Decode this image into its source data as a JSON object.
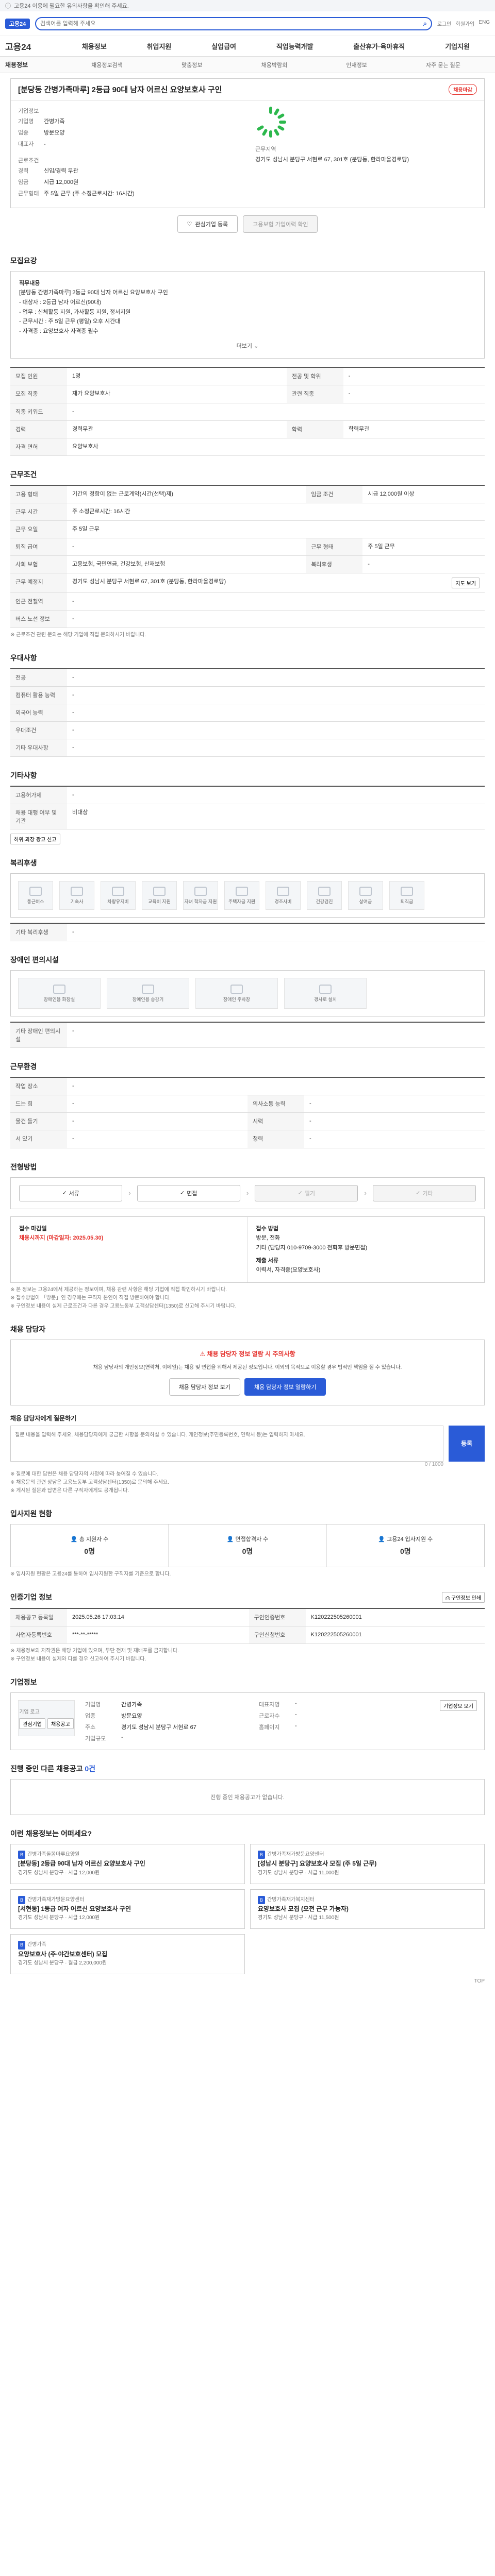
{
  "notice": {
    "text": "고용24 이용에 필요한 유의사항을 확인해 주세요.",
    "close": "닫기"
  },
  "topbar": {
    "logo": "고용24",
    "search_placeholder": "검색어를 입력해 주세요",
    "links": [
      "로그인",
      "회원가입",
      "ENG"
    ]
  },
  "gnb": {
    "brand": "고용24",
    "items": [
      "채용정보",
      "취업지원",
      "실업급여",
      "직업능력개발",
      "출산휴가·육아휴직",
      "기업지원"
    ]
  },
  "lnb": {
    "title": "채용정보",
    "items": [
      "채용정보검색",
      "맞춤정보",
      "채용박람회",
      "인재정보",
      "자주 묻는 질문"
    ]
  },
  "job": {
    "title": "[분당동 간병가족마루] 2등급 90대 남자 어르신 요양보호사 구인",
    "status": "채용마감",
    "company_label": "기업정보",
    "company": [
      {
        "k": "기업명",
        "v": "간병가족"
      },
      {
        "k": "업종",
        "v": "방문요양"
      },
      {
        "k": "대표자",
        "v": "-"
      }
    ],
    "work_label": "근로조건",
    "work": [
      {
        "k": "경력",
        "v": "신입/경력 무관"
      },
      {
        "k": "임금",
        "v": "시급 12,000원"
      },
      {
        "k": "근무형태",
        "v": "주 5일 근무 (주 소정근로시간: 16시간)"
      }
    ],
    "area_label": "근무지역",
    "area": "경기도 성남시 분당구 서현로 67, 301호 (분당동, 한라마을경로당)",
    "apply_btn": "관심기업 등록",
    "consult_btn": "고용보험 가입이력 확인",
    "share_btn": "공유하기"
  },
  "duty": {
    "heading": "모집요강",
    "body": [
      "직무내용",
      "[분당동 간병가족마루] 2등급 90대 남자 어르신 요양보호사 구인",
      "- 대상자 : 2등급 남자 어르신(90대)",
      "- 업무 : 신체활동 지원, 가사활동 지원, 정서지원",
      "- 근무시간 : 주 5일 근무 (평일) 오후 시간대",
      "- 자격증 : 요양보호사 자격증 필수"
    ],
    "more": "더보기"
  },
  "recruit_table": [
    {
      "k": "모집 인원",
      "v": "1명",
      "k2": "전공 및 학위",
      "v2": "-"
    },
    {
      "k": "모집 직종",
      "v": "재가 요양보호사",
      "k2": "관련 직종",
      "v2": "-"
    },
    {
      "k": "직종 키워드",
      "v": "-",
      "k2": "",
      "v2": ""
    },
    {
      "k": "경력",
      "v": "경력무관",
      "k2": "학력",
      "v2": "학력무관"
    },
    {
      "k": "자격 면허",
      "v": "요양보호사",
      "k2": "",
      "v2": ""
    }
  ],
  "work_cond": {
    "heading": "근무조건",
    "rows": [
      {
        "k": "고용 형태",
        "v": "기간의 정함이 없는 근로계약(시간(선택)제)",
        "k2": "임금 조건",
        "v2": "시급 12,000원 이상"
      },
      {
        "k": "근무 시간",
        "v": "주 소정근로시간: 16시간",
        "k2": "",
        "v2": ""
      },
      {
        "k": "근무 요일",
        "v": "주 5일 근무",
        "k2": "",
        "v2": ""
      },
      {
        "k": "퇴직 급여",
        "v": "-",
        "k2": "근무 형태",
        "v2": "주 5일 근무"
      },
      {
        "k": "사회 보험",
        "v": "고용보험, 국민연금, 건강보험, 산재보험",
        "k2": "복리후생",
        "v2": "-"
      },
      {
        "k": "근무 예정지",
        "v": "경기도 성남시 분당구 서현로 67, 301호 (분당동, 한라마을경로당)",
        "k2": "",
        "v2": ""
      },
      {
        "k": "인근 전철역",
        "v": "-",
        "k2": "",
        "v2": ""
      },
      {
        "k": "버스 노선 정보",
        "v": "-",
        "k2": "",
        "v2": ""
      }
    ],
    "map_btn": "지도 보기",
    "note": "※ 근로조건 관련 문의는 해당 기업에 직접 문의하시기 바랍니다."
  },
  "pref": {
    "heading": "우대사항",
    "rows": [
      {
        "k": "전공",
        "v": "-"
      },
      {
        "k": "컴퓨터 활용 능력",
        "v": "-"
      },
      {
        "k": "외국어 능력",
        "v": "-"
      },
      {
        "k": "우대조건",
        "v": "-"
      },
      {
        "k": "기타 우대사항",
        "v": "-"
      }
    ]
  },
  "etc": {
    "heading": "기타사항",
    "rows": [
      {
        "k": "고용허가제",
        "v": "-"
      },
      {
        "k": "채용 대행 여부 및 기관",
        "v": "비대상"
      }
    ],
    "report_btn": "허위·과장 광고 신고"
  },
  "welfare": {
    "heading": "복리후생",
    "items": [
      "통근버스",
      "기숙사",
      "차량유지비",
      "교육비 지원",
      "자녀 학자금 지원",
      "주택자금 지원",
      "경조사비",
      "건강검진",
      "상여금",
      "퇴직금"
    ],
    "etc_label": "기타 복리후생",
    "etc": "-"
  },
  "disabled": {
    "heading": "장애인 편의시설",
    "items": [
      "장애인용 화장실",
      "장애인용 승강기",
      "장애인 주차장",
      "경사로 설치"
    ],
    "etc_label": "기타 장애인 편의시설",
    "etc": "-"
  },
  "welfare_extra": {
    "heading": "근무환경",
    "rows": [
      {
        "k": "작업 장소",
        "v": "-",
        "k2": "",
        "v2": ""
      },
      {
        "k": "드는 힘",
        "v": "-",
        "k2": "의사소통 능력",
        "v2": "-"
      },
      {
        "k": "물건 들기",
        "v": "-",
        "k2": "시력",
        "v2": "-"
      },
      {
        "k": "서 있기",
        "v": "-",
        "k2": "청력",
        "v2": "-"
      }
    ]
  },
  "process": {
    "heading": "전형방법",
    "steps": [
      {
        "label": "서류",
        "on": true
      },
      {
        "label": "면접",
        "on": true
      },
      {
        "label": "필기",
        "on": false
      },
      {
        "label": "기타",
        "on": false
      }
    ]
  },
  "apply": {
    "left_label": "접수 마감일",
    "left_value": "채용시까지 (마감일자: 2025.05.30)",
    "right_label": "접수 방법",
    "right_items": [
      "방문, 전화",
      "기타 (담당자 010-9709-3000 전화후 방문면접)"
    ],
    "doc_label": "제출 서류",
    "doc": "이력서, 자격증(요양보호사)"
  },
  "apply_notes": [
    "※ 본 정보는 고용24에서 제공하는 정보이며, 채용 관련 사항은 해당 기업에 직접 확인하시기 바랍니다.",
    "※ 접수방법이 「방문」인 경우에는 구직자 본인이 직접 방문하여야 합니다.",
    "※ 구인정보 내용이 실제 근로조건과 다른 경우 고용노동부 고객상담센터(1350)로 신고해 주시기 바랍니다."
  ],
  "inquiry": {
    "heading": "채용 담당자",
    "warn": "채용 담당자 정보 열람 시 주의사항",
    "desc": "채용 담당자의 개인정보(연락처, 이메일)는 채용 및 면접을 위해서 제공된 정보입니다. 이외의 목적으로 이용할 경우 법적인 책임을 질 수 있습니다.",
    "btn_left": "채용 담당자 정보 보기",
    "btn_right": "채용 담당자 정보 열람하기"
  },
  "qa": {
    "heading": "채용 담당자에게 질문하기",
    "placeholder": "질문 내용을 입력해 주세요. 채용담당자에게 궁금한 사항을 문의하실 수 있습니다. 개인정보(주민등록번호, 연락처 등)는 입력하지 마세요.",
    "count": "0 / 1000",
    "submit": "등록",
    "notes": [
      "※ 질문에 대한 답변은 채용 담당자의 사정에 따라 늦어질 수 있습니다.",
      "※ 채용문의 관련 상담은 고용노동부 고객상담센터(1350)로 문의해 주세요.",
      "※ 게시된 질문과 답변은 다른 구직자에게도 공개됩니다."
    ]
  },
  "hire_stats": {
    "heading": "입사지원 현황",
    "cards": [
      {
        "label": "총 지원자 수",
        "value": "0명"
      },
      {
        "label": "면접합격자 수",
        "value": "0명"
      },
      {
        "label": "고용24 입사지원 수",
        "value": "0명"
      }
    ],
    "note": "※ 입사지원 현황은 고용24를 통하여 입사지원한 구직자를 기준으로 합니다."
  },
  "meta": {
    "heading": "인증기업 정보",
    "print_btn": "구인정보 인쇄",
    "rows": [
      {
        "k": "채용공고 등록일",
        "v": "2025.05.26 17:03:14",
        "k2": "구인인증번호",
        "v2": "K120222505260001"
      },
      {
        "k": "사업자등록번호",
        "v": "***-**-*****",
        "k2": "구인신청번호",
        "v2": "K120222505260001"
      }
    ],
    "notes": [
      "※ 채용정보의 저작권은 해당 기업에 있으며, 무단 전재 및 재배포를 금지합니다.",
      "※ 구인정보 내용이 실제와 다를 경우 신고하여 주시기 바랍니다."
    ]
  },
  "agency": {
    "heading": "기업정보",
    "logo": "기업 로고",
    "info": [
      {
        "k": "기업명",
        "v": "간병가족"
      },
      {
        "k": "대표자명",
        "v": "-"
      },
      {
        "k": "업종",
        "v": "방문요양"
      },
      {
        "k": "근로자수",
        "v": "-"
      },
      {
        "k": "주소",
        "v": "경기도 성남시 분당구 서현로 67"
      },
      {
        "k": "홈페이지",
        "v": "-"
      },
      {
        "k": "기업규모",
        "v": "-"
      }
    ],
    "btn": "기업정보 보기",
    "btn2": "관심기업",
    "btn3": "채용공고"
  },
  "other_jobs": {
    "heading": "진행 중인 다른 채용공고",
    "count": "0건",
    "empty": "진행 중인 채용공고가 없습니다."
  },
  "rec": {
    "heading": "이런 채용정보는 어떠세요?",
    "cards": [
      {
        "co": "간병가족돌봄마루요양원",
        "title": "[분당동] 2등급 90대 남자 어르신 요양보호사 구인",
        "meta": "경기도 성남시 분당구 · 시급 12,000원"
      },
      {
        "co": "간병가족재가방문요양센터",
        "title": "[성남시 분당구] 요양보호사 모집 (주 5일 근무)",
        "meta": "경기도 성남시 분당구 · 시급 11,000원"
      },
      {
        "co": "간병가족재가방문요양센터",
        "title": "[서현동] 1등급 여자 어르신 요양보호사 구인",
        "meta": "경기도 성남시 분당구 · 시급 12,000원"
      },
      {
        "co": "간병가족재가복지센터",
        "title": "요양보호사 모집 (오전 근무 가능자)",
        "meta": "경기도 성남시 분당구 · 시급 11,500원"
      },
      {
        "co": "간병가족",
        "title": "요양보호사 (주·야간보호센터) 모집",
        "meta": "경기도 성남시 분당구 · 월급 2,200,000원"
      }
    ],
    "back_top": "TOP"
  }
}
